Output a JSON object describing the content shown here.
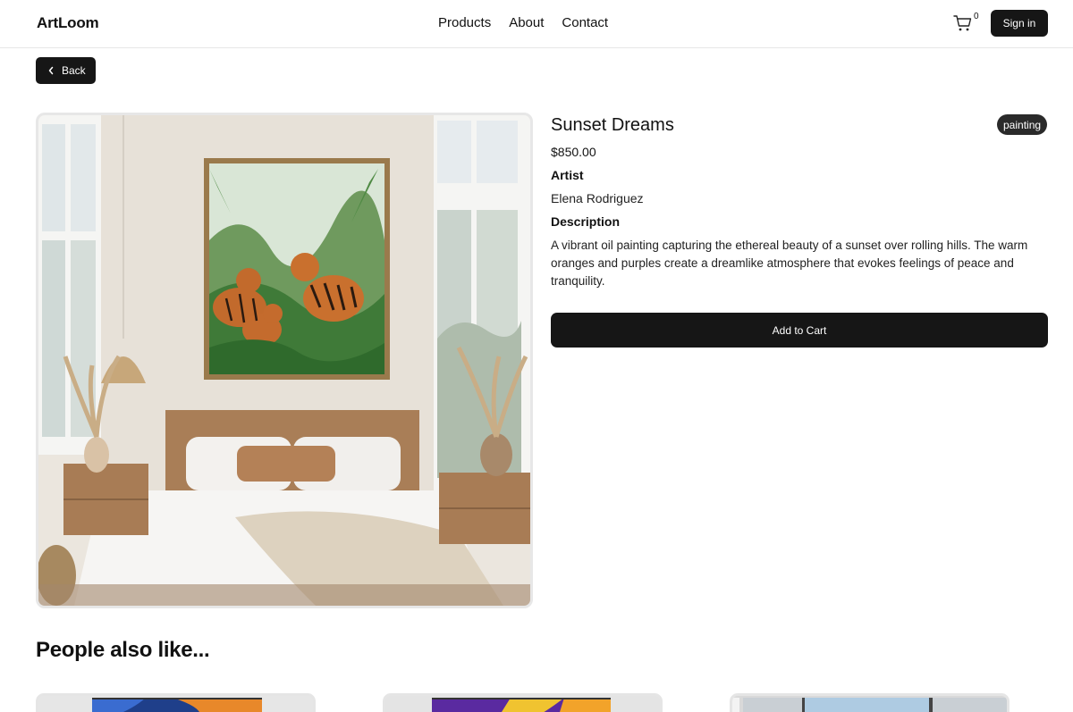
{
  "header": {
    "logo": "ArtLoom",
    "nav": [
      "Products",
      "About",
      "Contact"
    ],
    "cart_count": "0",
    "cart_icon": "cart-icon",
    "signin_label": "Sign in"
  },
  "back": {
    "label": "Back",
    "icon": "chevron-left-icon"
  },
  "product": {
    "title": "Sunset Dreams",
    "category": "painting",
    "price": "$850.00",
    "artist_label": "Artist",
    "artist": "Elena Rodriguez",
    "description_label": "Description",
    "description": "A vibrant oil painting capturing the ethereal beauty of a sunset over rolling hills. The warm oranges and purples create a dreamlike atmosphere that evokes feelings of peace and tranquility.",
    "add_to_cart_label": "Add to Cart"
  },
  "also_like": {
    "title": "People also like..."
  },
  "colors": {
    "primary": "#161616",
    "border": "#e7e7e7"
  }
}
